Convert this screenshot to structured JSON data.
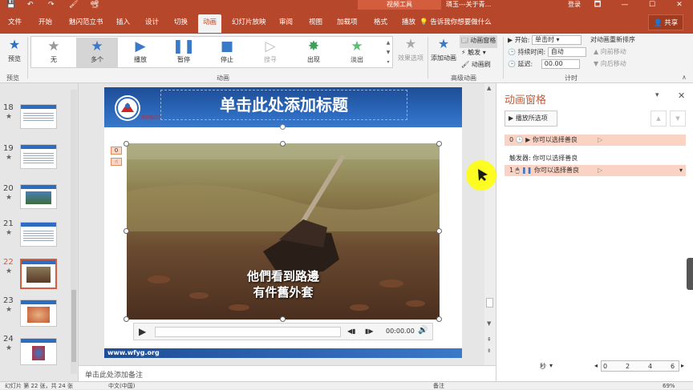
{
  "titlebar": {
    "quick_access": [
      "💾",
      "↶",
      "↷",
      "🖌",
      "📽"
    ],
    "context_tools": "视频工具",
    "doc_title": "璘玉---关于青...",
    "login": "登录",
    "window_buttons": [
      "🗖",
      "—",
      "☐",
      "✕"
    ]
  },
  "tabs": [
    "文件",
    "开始",
    "魅闪范立书",
    "插入",
    "设计",
    "切换",
    "动画",
    "幻灯片放映",
    "审阅",
    "视图",
    "加载项",
    "格式",
    "播放"
  ],
  "active_tab": "动画",
  "tellme": "告诉我你想要做什么",
  "share": "共享",
  "ribbon": {
    "preview": "预览",
    "preview_group": "预览",
    "animations": [
      {
        "label": "无",
        "icon": "star"
      },
      {
        "label": "多个",
        "icon": "star"
      },
      {
        "label": "播放",
        "icon": "play"
      },
      {
        "label": "暂停",
        "icon": "pause"
      },
      {
        "label": "停止",
        "icon": "stop"
      },
      {
        "label": "搜寻",
        "icon": "seek"
      },
      {
        "label": "出现",
        "icon": "star"
      },
      {
        "label": "淡出",
        "icon": "star"
      }
    ],
    "animation_group": "动画",
    "effect_options": "效果选项",
    "add_animation": "添加动画",
    "anim_pane_btn": "动画窗格",
    "trigger_btn": "触发",
    "painter_btn": "动画刷",
    "advanced_group": "高级动画",
    "start_label": "开始:",
    "start_value": "单击时",
    "duration_label": "持续时间:",
    "duration_value": "自动",
    "delay_label": "延迟:",
    "delay_value": "00.00",
    "reorder_label": "对动画重新排序",
    "move_earlier": "向前移动",
    "move_later": "向后移动",
    "timing_group": "计时"
  },
  "slides": [
    {
      "num": "18",
      "star": "★"
    },
    {
      "num": "19",
      "star": "★"
    },
    {
      "num": "20",
      "star": "★"
    },
    {
      "num": "21",
      "star": "★"
    },
    {
      "num": "22",
      "star": "★"
    },
    {
      "num": "23",
      "star": "★"
    },
    {
      "num": "24",
      "star": "★"
    }
  ],
  "slide": {
    "title_placeholder": "单击此处添加标题",
    "logo_text": "莲花福之乐",
    "footer_url": "www.wfyg.org",
    "subtitle_line1": "他們看到路邊",
    "subtitle_line2": "有件舊外套",
    "badge1": "0",
    "badge2": "☝",
    "video_time": "00:00.00"
  },
  "notes_placeholder": "单击此处添加备注",
  "anim_pane": {
    "title": "动画窗格",
    "play_selected": "播放所选项",
    "row1_index": "0",
    "row1_text": "你可以选择善良",
    "trigger_label": "触发器: 你可以选择善良",
    "row2_index": "1",
    "row2_text": "你可以选择善良",
    "seconds_label": "秒",
    "ticks": [
      "0",
      "2",
      "4",
      "6"
    ]
  },
  "statusbar": {
    "slide_info": "幻灯片 第 22 张，共 24 张",
    "language": "中文(中国)",
    "notes": "备注",
    "zoom": "69%"
  }
}
